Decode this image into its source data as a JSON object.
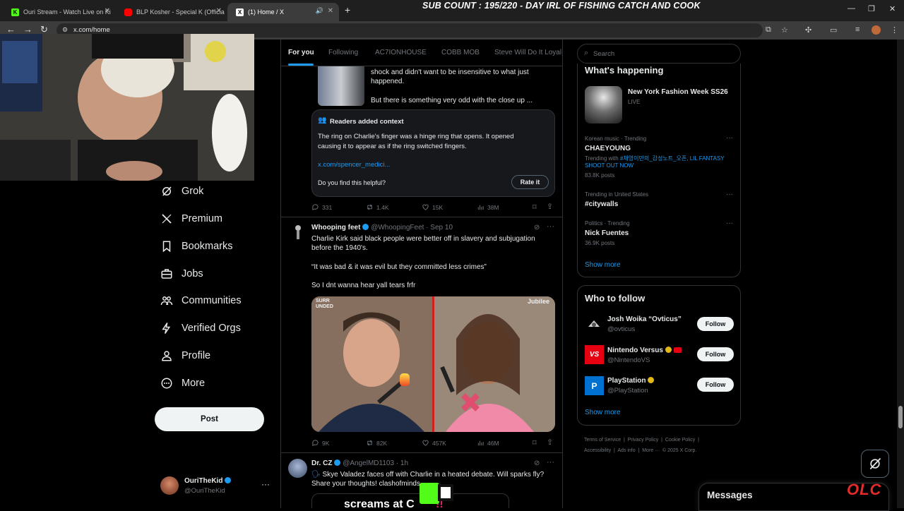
{
  "browser": {
    "tabs": [
      {
        "label": "Ouri Stream - Watch Live on Ki",
        "favicon_text": "K",
        "favicon_color": "#53fc18"
      },
      {
        "label": "BLP Kosher - Special K (Officia",
        "favicon_text": "",
        "favicon_color": "#ff0000"
      },
      {
        "label": "(1) Home / X",
        "favicon_text": "X",
        "favicon_color": "#ffffff"
      }
    ],
    "url": "x.com/home",
    "overlay_title": "SUB COUNT : 195/220 - DAY IRL OF FISHING CATCH AND COOK"
  },
  "nav": {
    "items": [
      {
        "label": "Grok",
        "icon": "grok-icon"
      },
      {
        "label": "Premium",
        "icon": "x-logo-icon"
      },
      {
        "label": "Bookmarks",
        "icon": "bookmark-icon"
      },
      {
        "label": "Jobs",
        "icon": "briefcase-icon"
      },
      {
        "label": "Communities",
        "icon": "people-icon"
      },
      {
        "label": "Verified Orgs",
        "icon": "lightning-icon"
      },
      {
        "label": "Profile",
        "icon": "person-icon"
      },
      {
        "label": "More",
        "icon": "more-circle-icon"
      }
    ],
    "post_label": "Post",
    "account": {
      "name": "OuriTheKid",
      "handle": "@OuriTheKid"
    }
  },
  "feed": {
    "tabs": [
      "For you",
      "Following",
      "AC7IONHOUSE",
      "COBB MOB",
      "Steve Will Do It Loyal"
    ],
    "tweet1": {
      "text_line1": "shock and didn't want to be insensitive to what just",
      "text_line2": "happened.",
      "text_line3": "But there is something very odd with the close up ...",
      "note_title": "Readers added context",
      "note_line1": "The ring on Charlie's finger was a hinge ring that opens. It opened",
      "note_line2": "causing it to appear as if the ring switched fingers.",
      "note_link": "x.com/spencer_medici...",
      "helpful_question": "Do you find this helpful?",
      "rate_label": "Rate it",
      "replies": "331",
      "reposts": "1.4K",
      "likes": "15K",
      "views": "38M"
    },
    "tweet2": {
      "name": "Whooping feet",
      "handle": "@WhoopingFeet",
      "date": "· Sep 10",
      "line1": "Charlie Kirk said black people were better off in slavery and subjugation",
      "line2": "before the 1940's.",
      "line3": "“It was bad & it was evil but they committed less crimes”",
      "line4": "So I dnt wanna hear yall tears frfr",
      "media_label_left": "SURR UNDED",
      "media_label_right": "Jubilee",
      "replies": "9K",
      "reposts": "82K",
      "likes": "457K",
      "views": "46M"
    },
    "tweet3": {
      "name": "Dr. CZ",
      "handle": "@AngelMD1103",
      "date": "· 1h",
      "line1": "Skye Valadez faces off with Charlie in a heated debate. Will sparks fly?",
      "line2": "Share your thoughts! clashofminds",
      "media_caption": "screams at C"
    }
  },
  "sidebar": {
    "search_placeholder": "Search",
    "happening_title": "What's happening",
    "event": {
      "title": "New York Fashion Week SS26",
      "status": "LIVE"
    },
    "trends": [
      {
        "meta": "Korean music · Trending",
        "name": "CHAEYOUNG",
        "extra_prefix": "Trending with ",
        "extra_link": "#채영이만의_감성노트_오픈, LIL FANTASY SHOOT OUT NOW",
        "posts": "83.8K posts"
      },
      {
        "meta": "Trending in United States",
        "name": "#citywalls",
        "posts": ""
      },
      {
        "meta": "Politics · Trending",
        "name": "Nick Fuentes",
        "posts": "36.9K posts"
      }
    ],
    "show_more": "Show more",
    "wtf_title": "Who to follow",
    "wtf": [
      {
        "name": "Josh Woika “Ovticus”",
        "handle": "@ovticus",
        "follow": "Follow"
      },
      {
        "name": "Nintendo Versus",
        "handle": "@NintendoVS",
        "follow": "Follow"
      },
      {
        "name": "PlayStation",
        "handle": "@PlayStation",
        "follow": "Follow"
      }
    ],
    "footer_line1": "Terms of Service  |  Privacy Policy  |  Cookie Policy  |",
    "footer_line2": "Accessibility  |  Ads info  |  More ···  © 2025 X Corp.",
    "messages_label": "Messages",
    "watermark": "OLC"
  },
  "colors": {
    "accent": "#1d9bf0",
    "bg": "#000000",
    "border": "#2f3336",
    "muted": "#71767b"
  }
}
